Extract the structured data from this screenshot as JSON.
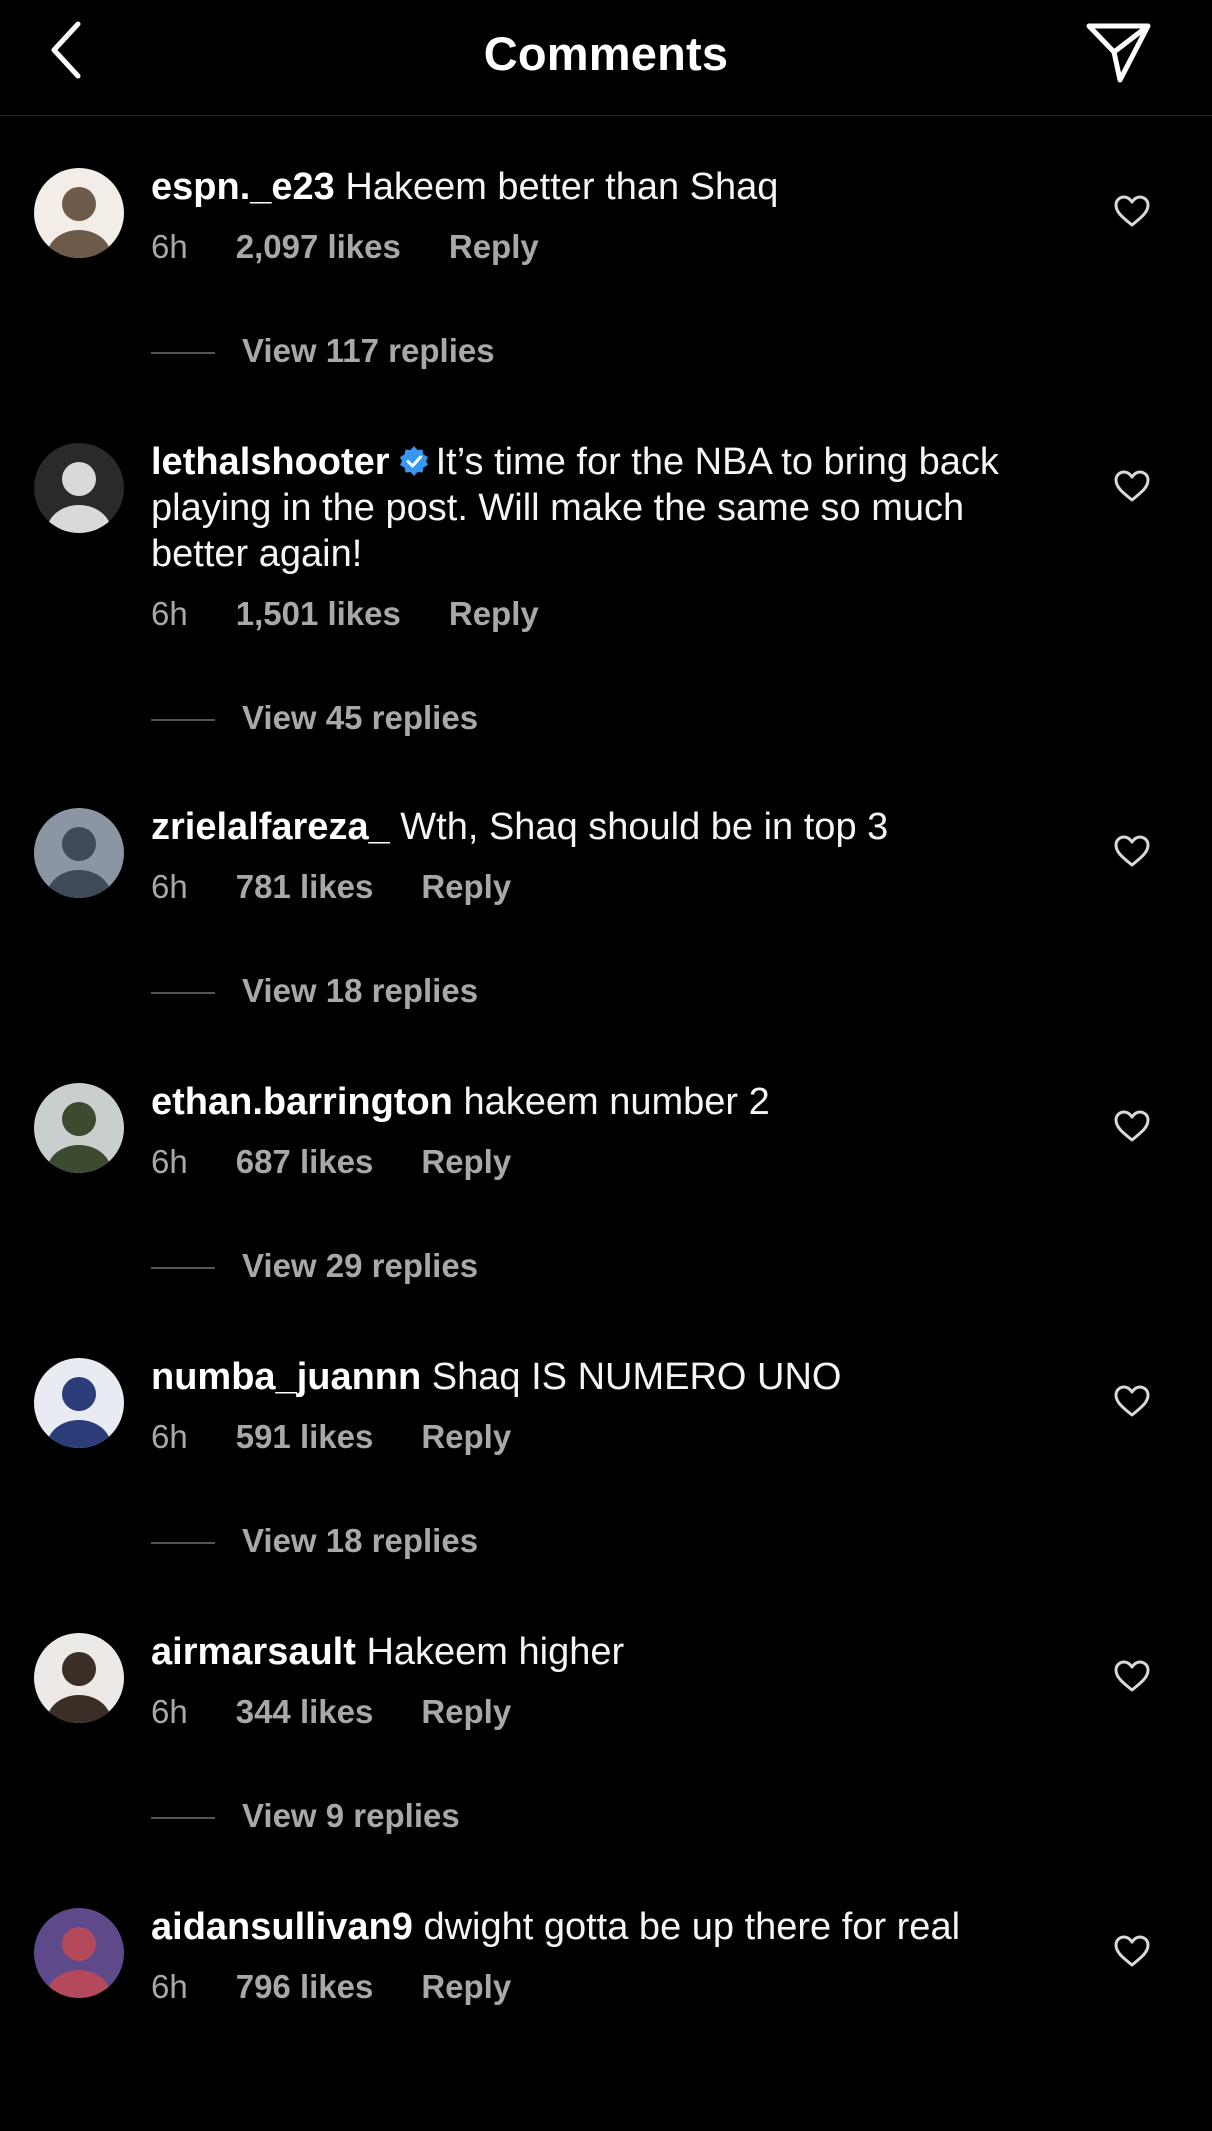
{
  "header": {
    "title": "Comments",
    "back_icon": "chevron-left-icon",
    "send_icon": "paper-plane-icon"
  },
  "comments": [
    {
      "username": "espn._e23",
      "verified": false,
      "text": "Hakeem better than Shaq",
      "time": "6h",
      "likes": "2,097 likes",
      "reply": "Reply",
      "view_replies": "View 117 replies",
      "avatar_colors": [
        "#f2ede6",
        "#6d5a49"
      ]
    },
    {
      "username": "lethalshooter",
      "verified": true,
      "text": "It’s time for the NBA to bring back playing in the post. Will make the same so much better again!",
      "time": "6h",
      "likes": "1,501 likes",
      "reply": "Reply",
      "view_replies": "View 45 replies",
      "avatar_colors": [
        "#2a2a2a",
        "#d9d9d9"
      ]
    },
    {
      "username": "zrielalfareza_",
      "verified": false,
      "text": "Wth, Shaq should be in top 3",
      "time": "6h",
      "likes": "781 likes",
      "reply": "Reply",
      "view_replies": "View 18 replies",
      "avatar_colors": [
        "#8b95a3",
        "#3f4957"
      ]
    },
    {
      "username": "ethan.barrington",
      "verified": false,
      "text": "hakeem number 2",
      "time": "6h",
      "likes": "687 likes",
      "reply": "Reply",
      "view_replies": "View 29 replies",
      "avatar_colors": [
        "#c9cfcf",
        "#3c4a30"
      ]
    },
    {
      "username": "numba_juannn",
      "verified": false,
      "text": "Shaq IS NUMERO UNO",
      "time": "6h",
      "likes": "591 likes",
      "reply": "Reply",
      "view_replies": "View 18 replies",
      "avatar_colors": [
        "#e8ecf2",
        "#2c3d7a"
      ]
    },
    {
      "username": "airmarsault",
      "verified": false,
      "text": "Hakeem higher",
      "time": "6h",
      "likes": "344 likes",
      "reply": "Reply",
      "view_replies": "View 9 replies",
      "avatar_colors": [
        "#ece9e6",
        "#3b2e27"
      ]
    },
    {
      "username": "aidansullivan9",
      "verified": false,
      "text": "dwight gotta be up there for real",
      "time": "6h",
      "likes": "796 likes",
      "reply": "Reply",
      "view_replies": "",
      "avatar_colors": [
        "#5e4a8a",
        "#b3495a"
      ]
    }
  ]
}
